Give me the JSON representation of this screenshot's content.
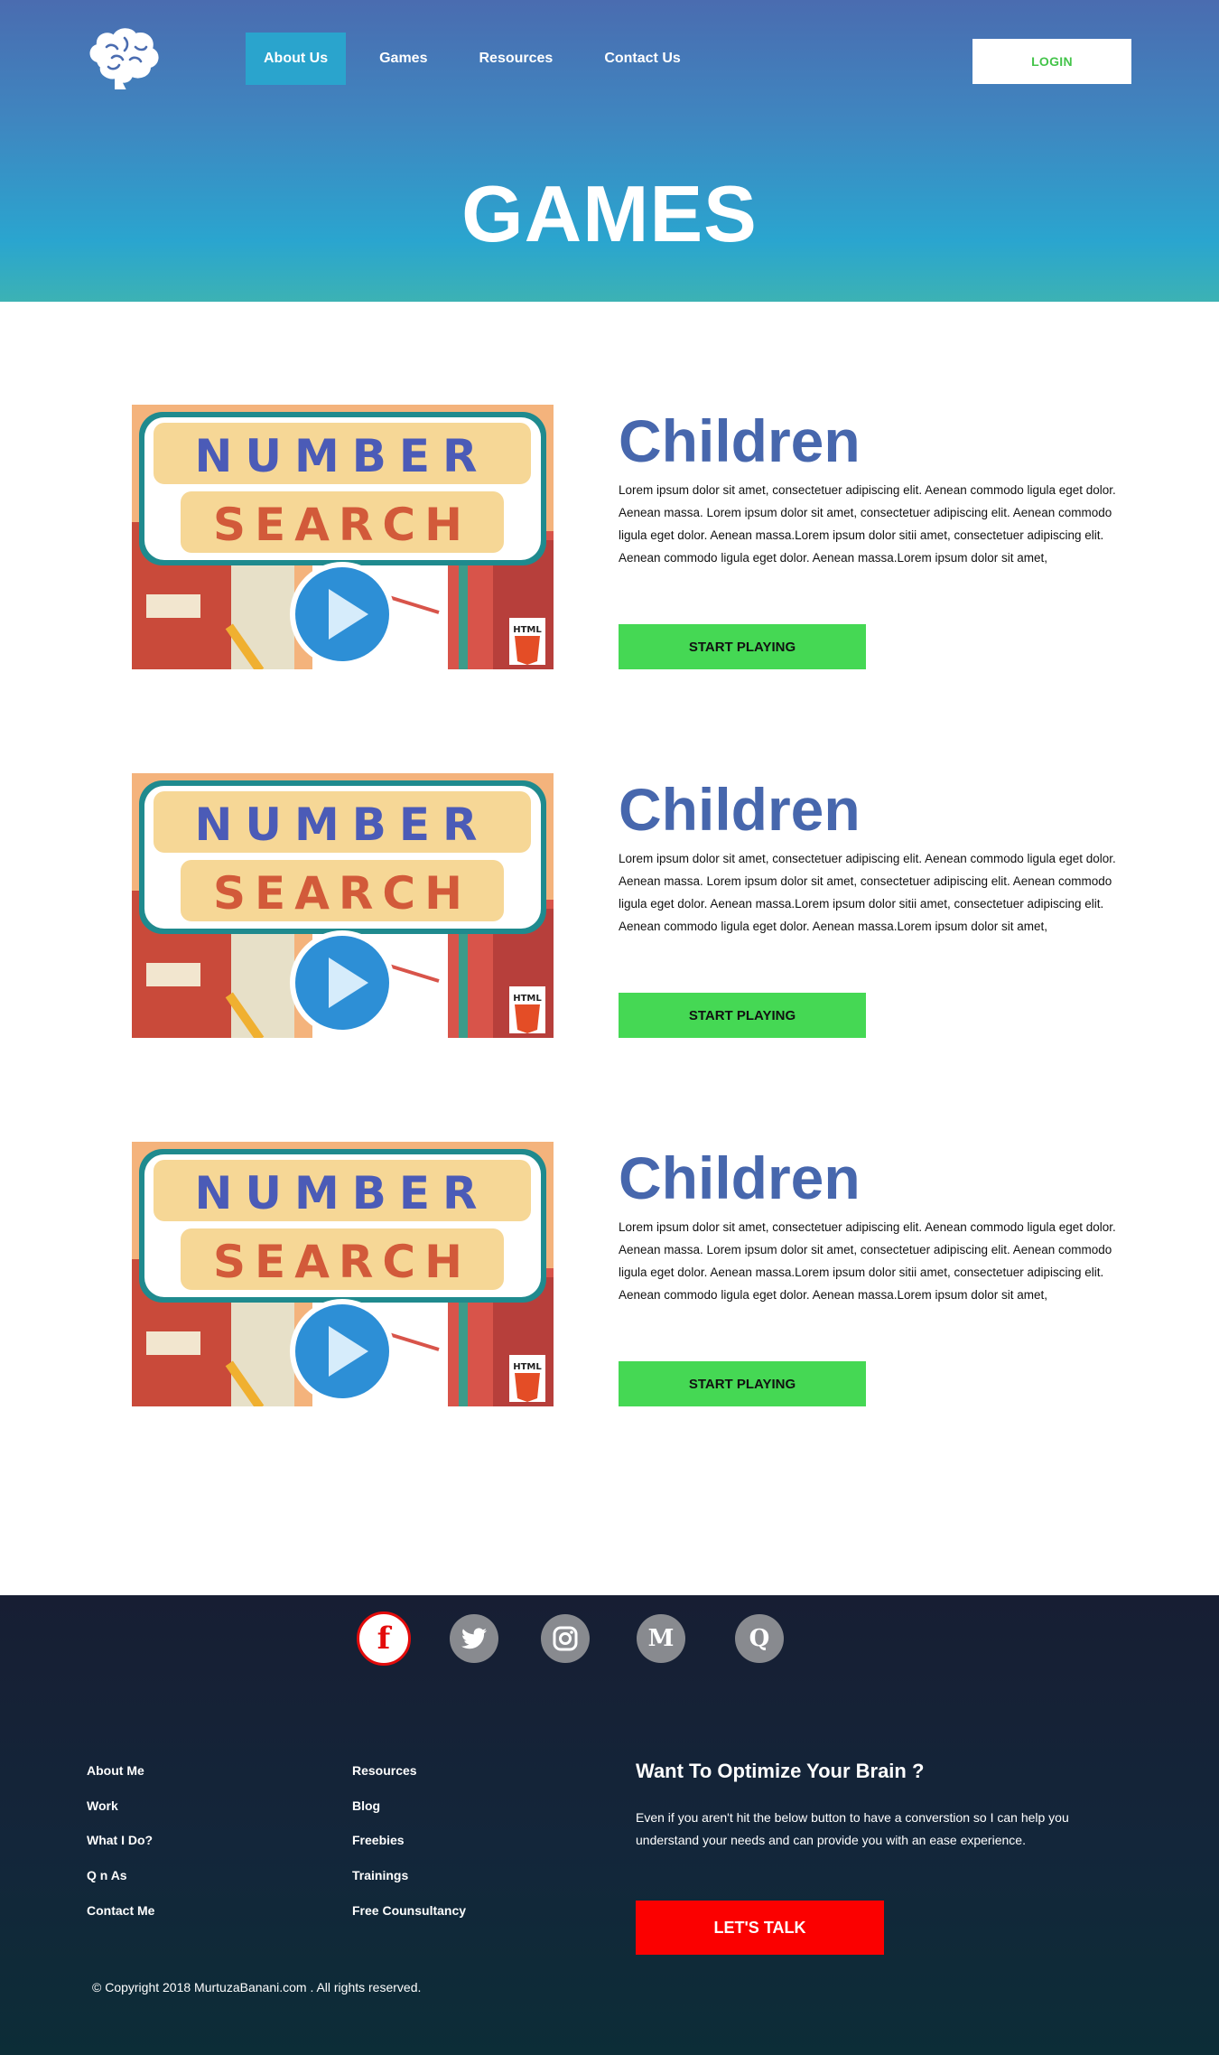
{
  "header": {
    "nav": [
      {
        "label": "About Us",
        "active": true
      },
      {
        "label": "Games",
        "active": false
      },
      {
        "label": "Resources",
        "active": false
      },
      {
        "label": "Contact Us",
        "active": false
      }
    ],
    "login_label": "LOGIN",
    "page_title": "GAMES"
  },
  "games": [
    {
      "title": "Children",
      "thumb_line1": "NUMBER",
      "thumb_line2": "SEARCH",
      "badge": "HTML",
      "description": "Lorem ipsum dolor sit amet, consectetuer adipiscing elit. Aenean commodo ligula eget dolor. Aenean massa. Lorem ipsum dolor sit amet, consectetuer adipiscing elit. Aenean commodo ligula eget dolor. Aenean massa.Lorem ipsum dolor sitii amet, consectetuer adipiscing elit. Aenean commodo ligula eget dolor. Aenean massa.Lorem ipsum dolor sit amet,",
      "button_label": "START PLAYING"
    },
    {
      "title": "Children",
      "thumb_line1": "NUMBER",
      "thumb_line2": "SEARCH",
      "badge": "HTML",
      "description": "Lorem ipsum dolor sit amet, consectetuer adipiscing elit. Aenean commodo ligula eget dolor. Aenean massa. Lorem ipsum dolor sit amet, consectetuer adipiscing elit. Aenean commodo ligula eget dolor. Aenean massa.Lorem ipsum dolor sitii amet, consectetuer adipiscing elit. Aenean commodo ligula eget dolor. Aenean massa.Lorem ipsum dolor sit amet,",
      "button_label": "START PLAYING"
    },
    {
      "title": "Children",
      "thumb_line1": "NUMBER",
      "thumb_line2": "SEARCH",
      "badge": "HTML",
      "description": "Lorem ipsum dolor sit amet, consectetuer adipiscing elit. Aenean commodo ligula eget dolor. Aenean massa. Lorem ipsum dolor sit amet, consectetuer adipiscing elit. Aenean commodo ligula eget dolor. Aenean massa.Lorem ipsum dolor sitii amet, consectetuer adipiscing elit. Aenean commodo ligula eget dolor. Aenean massa.Lorem ipsum dolor sit amet,",
      "button_label": "START PLAYING"
    }
  ],
  "footer": {
    "social": [
      {
        "icon": "facebook-icon",
        "glyph": "f"
      },
      {
        "icon": "twitter-icon",
        "glyph": ""
      },
      {
        "icon": "instagram-icon",
        "glyph": ""
      },
      {
        "icon": "medium-icon",
        "glyph": "M"
      },
      {
        "icon": "quora-icon",
        "glyph": "Q"
      }
    ],
    "col1": [
      "About Me",
      "Work",
      "What I Do?",
      "Q n As",
      "Contact Me"
    ],
    "col2": [
      "Resources",
      "Blog",
      "Freebies",
      "Trainings",
      "Free Counsultancy"
    ],
    "cta_title": "Want To Optimize Your Brain ?",
    "cta_text": "Even if you aren't hit the below button to have a converstion so I can help you understand your needs and can provide you with an ease experience.",
    "cta_button": "LET'S TALK",
    "copyright": "©  Copyright 2018 MurtuzaBanani.com . All rights reserved."
  },
  "colors": {
    "brand_blue": "#4767ad",
    "play_green": "#45d854",
    "talk_red": "#fb0000",
    "facebook_red": "#e30b0b"
  }
}
